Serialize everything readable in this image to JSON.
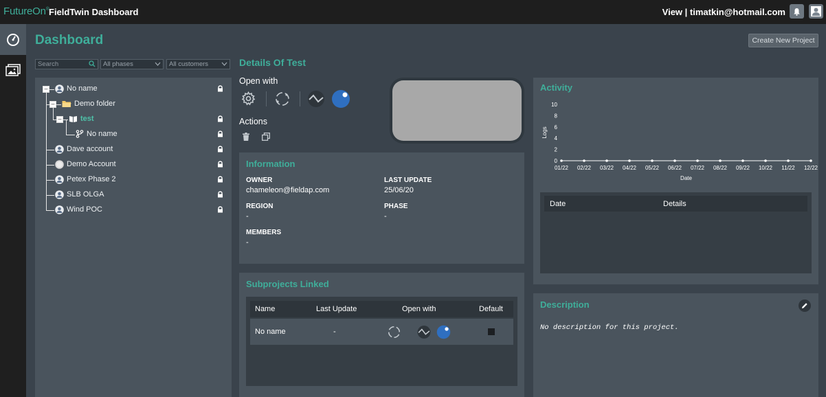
{
  "topbar": {
    "brand": "FutureOn",
    "brand_mark": "®",
    "app_title": "FieldTwin Dashboard",
    "user_text": "View | timatkin@hotmail.com"
  },
  "page": {
    "title": "Dashboard",
    "create_button": "Create New Project"
  },
  "filters": {
    "search_placeholder": "Search",
    "phases": "All phases",
    "customers": "All customers"
  },
  "tree": [
    {
      "label": "No name",
      "icon": "user-icon",
      "locked": true
    },
    {
      "label": "Demo folder",
      "icon": "folder-icon",
      "locked": false
    },
    {
      "label": "test",
      "icon": "book-icon",
      "locked": true,
      "active": true
    },
    {
      "label": "No name",
      "icon": "branch-icon",
      "locked": true
    },
    {
      "label": "Dave account",
      "icon": "user-icon",
      "locked": true
    },
    {
      "label": "Demo Account",
      "icon": "user-icon",
      "locked": true
    },
    {
      "label": "Petex Phase 2",
      "icon": "user-icon",
      "locked": true
    },
    {
      "label": "SLB OLGA",
      "icon": "user-icon",
      "locked": true
    },
    {
      "label": "Wind POC",
      "icon": "user-icon",
      "locked": true
    }
  ],
  "details": {
    "title": "Details Of Test",
    "open_with": "Open with",
    "actions": "Actions"
  },
  "information": {
    "title": "Information",
    "owner_label": "OWNER",
    "owner_value": "chameleon@fieldap.com",
    "last_update_label": "LAST UPDATE",
    "last_update_value": "25/06/20",
    "region_label": "REGION",
    "region_value": "-",
    "phase_label": "PHASE",
    "phase_value": "-",
    "members_label": "MEMBERS",
    "members_value": "-"
  },
  "subprojects": {
    "title": "Subprojects Linked",
    "columns": [
      "Name",
      "Last Update",
      "Open with",
      "Default"
    ],
    "rows": [
      {
        "name": "No name",
        "last_update": "-"
      }
    ]
  },
  "activity": {
    "title": "Activity",
    "table_columns": [
      "Date",
      "Details"
    ]
  },
  "chart_data": {
    "type": "line",
    "categories": [
      "01/22",
      "02/22",
      "03/22",
      "04/22",
      "05/22",
      "06/22",
      "07/22",
      "08/22",
      "09/22",
      "10/22",
      "11/22",
      "12/22"
    ],
    "values": [
      0,
      0,
      0,
      0,
      0,
      0,
      0,
      0,
      0,
      0,
      0,
      0
    ],
    "yticks": [
      0,
      2,
      4,
      6,
      8,
      10
    ],
    "ylim": [
      0,
      10
    ],
    "xlabel": "Date",
    "ylabel": "Logs"
  },
  "description": {
    "title": "Description",
    "text": "No description for this project."
  },
  "colors": {
    "accent": "#3fae9a",
    "panel": "#4a545d",
    "background": "#3a434c"
  }
}
